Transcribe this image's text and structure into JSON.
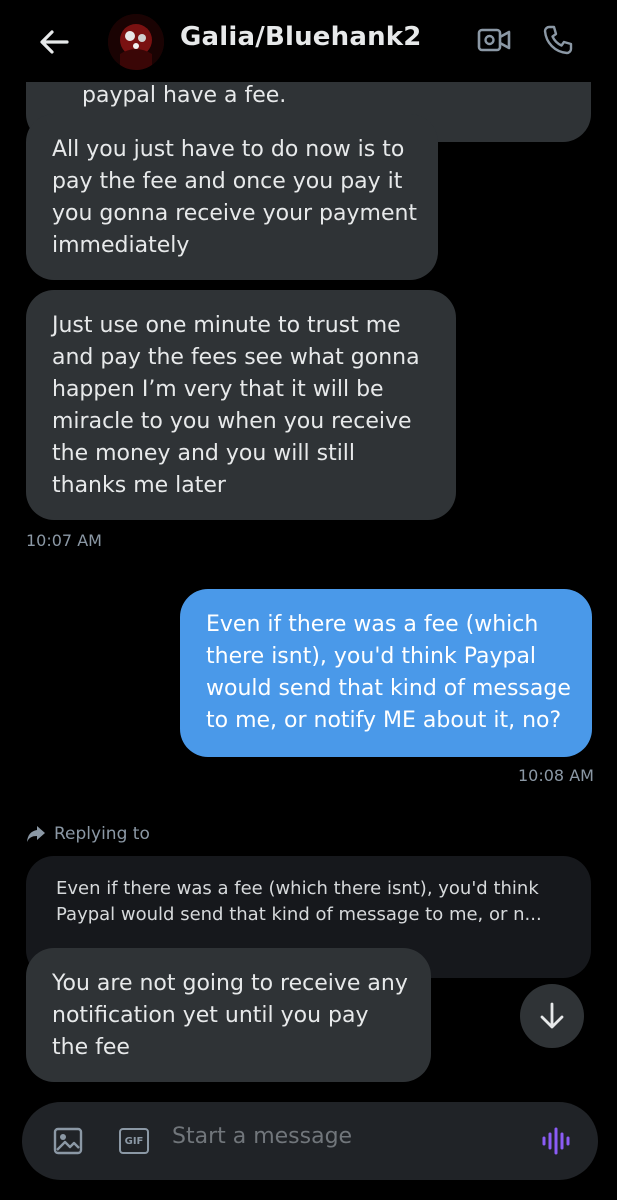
{
  "header": {
    "title": "Galia/Bluehank2"
  },
  "messages": [
    {
      "direction": "in",
      "text": "paypal have a fee."
    },
    {
      "direction": "in",
      "text": "All you just have to do now is to pay the fee and once you pay it you  gonna receive your payment immediately"
    },
    {
      "direction": "in",
      "text": "Just use one minute to trust me and pay the  fees  see what gonna happen I’m very that  it will be miracle to you when you receive the money and you will still thanks me later"
    }
  ],
  "timestamps": {
    "in_1": "10:07 AM",
    "out_1": "10:08 AM"
  },
  "outgoing": {
    "text": "Even if there was a fee (which there isnt), you'd think Paypal would send that kind of message to me, or notify ME about it, no?"
  },
  "reply": {
    "label": "Replying to",
    "quote": "Even if there was a fee (which there isnt), you'd think Paypal would send that kind of message to me, or n...",
    "text": "You are not going to receive any notification yet until you pay the fee"
  },
  "composer": {
    "placeholder": "Start a message",
    "gif_label": "GIF"
  },
  "colors": {
    "outgoing_bubble": "#4a99e9",
    "incoming_bubble": "#2f3336",
    "voice_accent": "#8b5cf6"
  }
}
